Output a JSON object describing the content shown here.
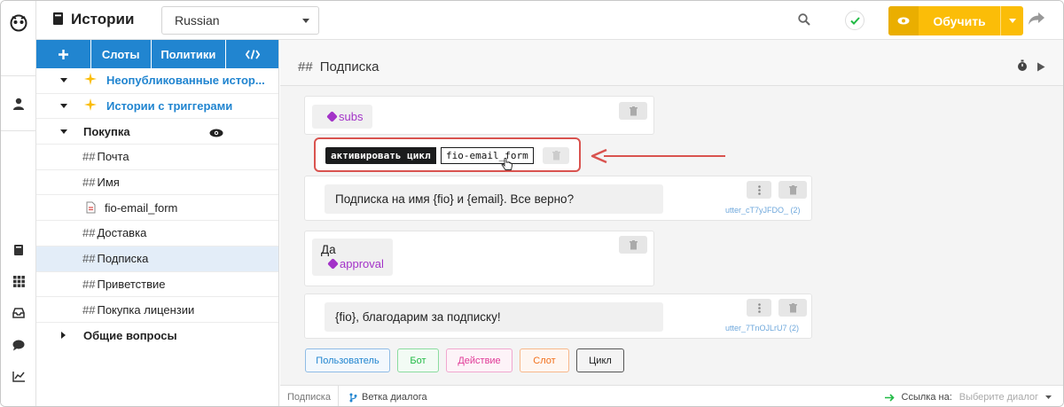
{
  "colors": {
    "primary_blue": "#2185d0",
    "train_yellow": "#fbbd08",
    "tag_purple": "#a333c8",
    "highlight_red": "#d9534f",
    "check_green": "#21ba45"
  },
  "header": {
    "title": "Истории",
    "language": "Russian",
    "train_label": "Обучить"
  },
  "sidebar": {
    "tabs": [
      {
        "label": "+",
        "icon": "plus-icon"
      },
      {
        "label": "Слоты"
      },
      {
        "label": "Политики"
      },
      {
        "label": "</>",
        "icon": "code-icon"
      }
    ],
    "items": [
      {
        "label": "Неопубликованные истор...",
        "type": "group-special",
        "icon": "sparkle-icon"
      },
      {
        "label": "Истории с триггерами",
        "type": "group-special",
        "icon": "sparkle-icon"
      },
      {
        "label": "Покупка",
        "type": "group",
        "icon": "eye-icon"
      },
      {
        "label": "Почта",
        "type": "story"
      },
      {
        "label": "Имя",
        "type": "story"
      },
      {
        "label": "fio-email_form",
        "type": "form",
        "icon": "form-icon"
      },
      {
        "label": "Доставка",
        "type": "story"
      },
      {
        "label": "Подписка",
        "type": "story",
        "selected": true
      },
      {
        "label": "Приветствие",
        "type": "story"
      },
      {
        "label": "Покупка лицензии",
        "type": "story"
      },
      {
        "label": "Общие вопросы",
        "type": "group-collapsed"
      }
    ],
    "hash": "##"
  },
  "main": {
    "title": "Подписка",
    "hash": "##",
    "intent1": "subs",
    "loop_label": "активировать цикл",
    "loop_value": "fio-email_form",
    "bot1_text": "Подписка на имя {fio} и {email}. Все верно?",
    "bot1_utter": "utter_cT7yJFDO_  (2)",
    "user2_text": "Да",
    "intent2": "approval",
    "bot2_text": "{fio}, благодарим за подписку!",
    "bot2_utter": "utter_7TnOJLrU7  (2)",
    "add_buttons": [
      "Пользователь",
      "Бот",
      "Действие",
      "Слот",
      "Цикл"
    ]
  },
  "bottom": {
    "breadcrumb": "Подписка",
    "branch_label": "Ветка диалога",
    "link_label": "Ссылка на:",
    "select_placeholder": "Выберите диалог"
  }
}
